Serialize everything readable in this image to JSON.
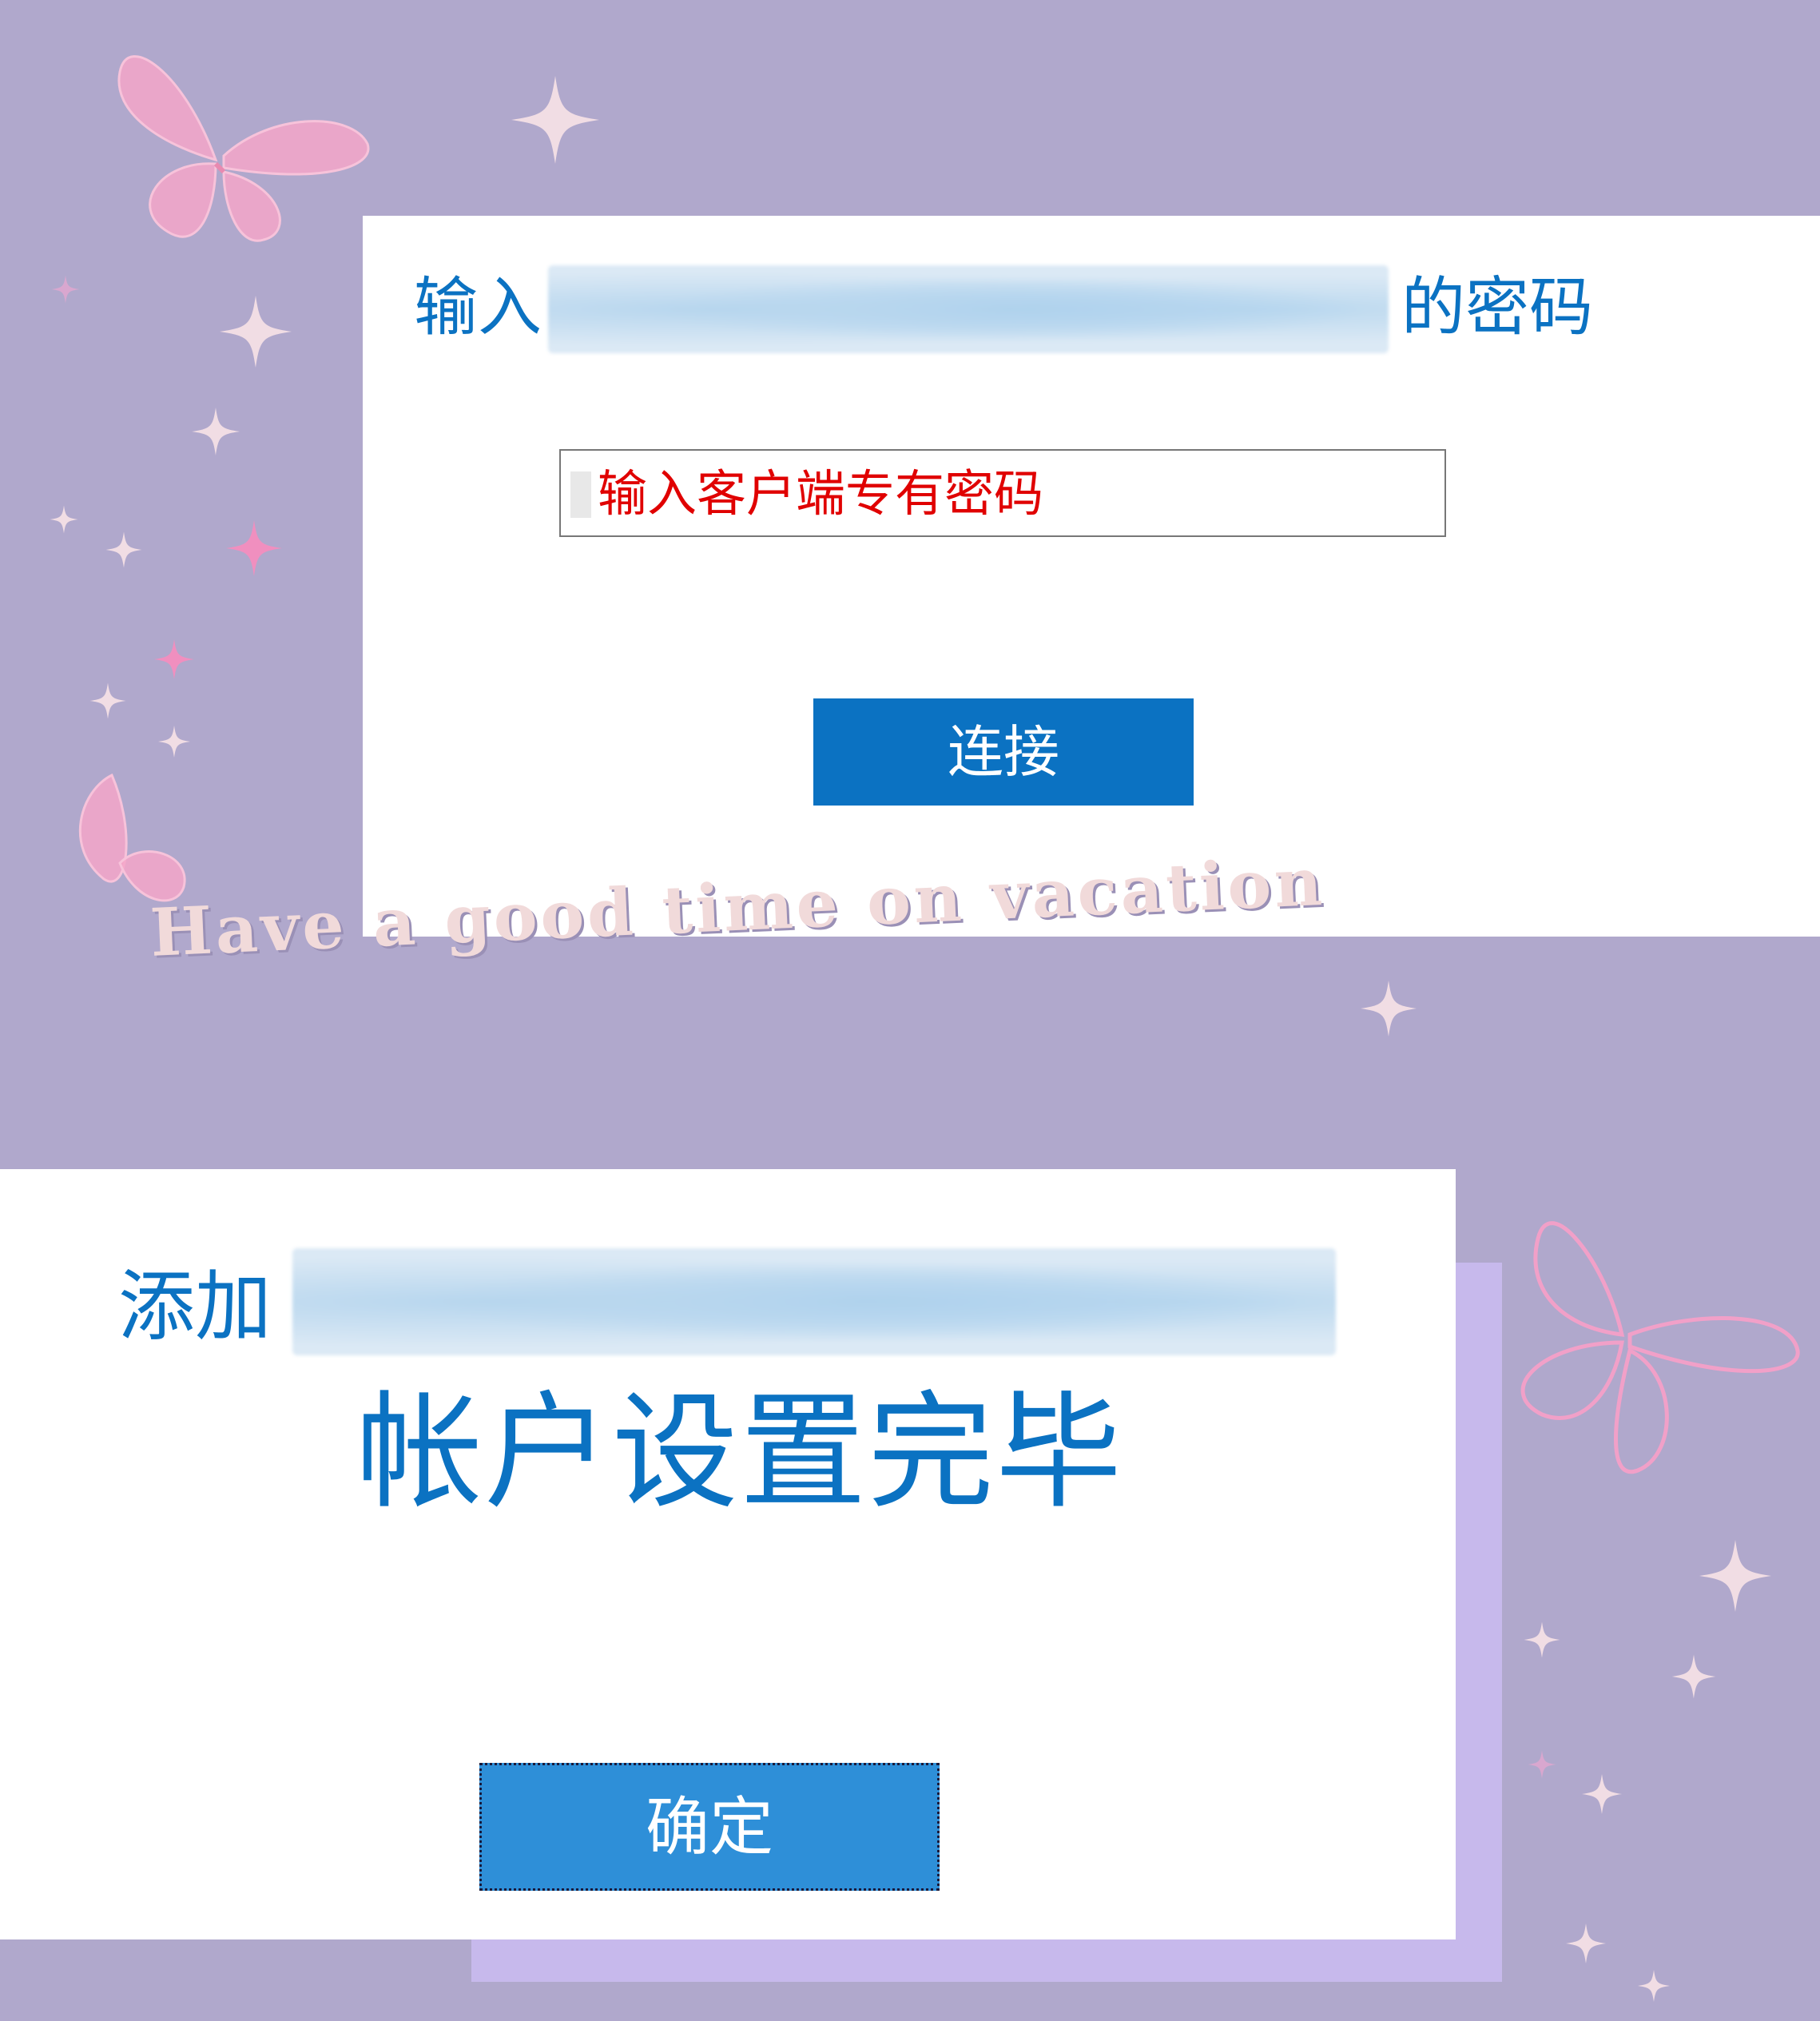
{
  "top_dialog": {
    "title_prefix": "输入",
    "title_suffix": "的密码",
    "password_placeholder": "输入客户端专有密码",
    "connect_label": "连接"
  },
  "bottom_dialog": {
    "title_prefix": "添加",
    "done_heading": "帐户设置完毕",
    "ok_label": "确定"
  },
  "decoration": {
    "caption": "Have a good time on vacation"
  },
  "colors": {
    "background": "#b0a8cc",
    "accent": "#0b72c2",
    "placeholder_red": "#e00000",
    "butterfly_pink": "#f4a6c8"
  },
  "icons": [
    "butterfly-icon",
    "sparkle-icon"
  ]
}
